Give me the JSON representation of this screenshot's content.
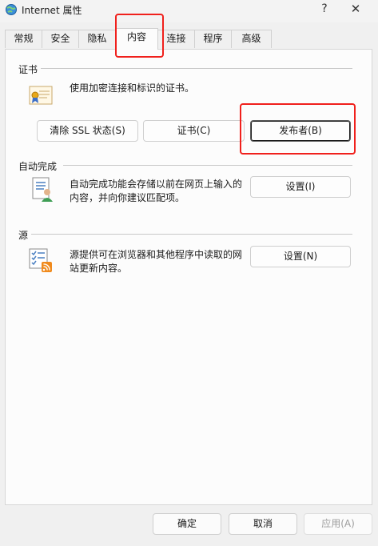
{
  "window": {
    "title": "Internet 属性",
    "help_label": "?",
    "close_label": "✕"
  },
  "tabs": [
    {
      "label": "常规"
    },
    {
      "label": "安全"
    },
    {
      "label": "隐私"
    },
    {
      "label": "内容",
      "active": true
    },
    {
      "label": "连接"
    },
    {
      "label": "程序"
    },
    {
      "label": "高级"
    }
  ],
  "certificates": {
    "group_label": "证书",
    "description": "使用加密连接和标识的证书。",
    "clear_ssl_label": "清除 SSL 状态(S)",
    "certificates_label": "证书(C)",
    "publishers_label": "发布者(B)",
    "icon": "certificate-icon"
  },
  "autocomplete": {
    "group_label": "自动完成",
    "description_line1": "自动完成功能会存储以前在网页上输入的",
    "description_line2": "内容，并向你建议匹配项。",
    "settings_label": "设置(I)",
    "icon": "autocomplete-icon"
  },
  "feeds": {
    "group_label": "源",
    "description_line1": "源提供可在浏览器和其他程序中读取的网",
    "description_line2": "站更新内容。",
    "settings_label": "设置(N)",
    "icon": "rss-feed-icon"
  },
  "footer": {
    "ok_label": "确定",
    "cancel_label": "取消",
    "apply_label": "应用(A)"
  },
  "colors": {
    "highlight": "#f0201c",
    "panel_bg": "#fcfcfc",
    "window_bg": "#f0f0f0"
  }
}
